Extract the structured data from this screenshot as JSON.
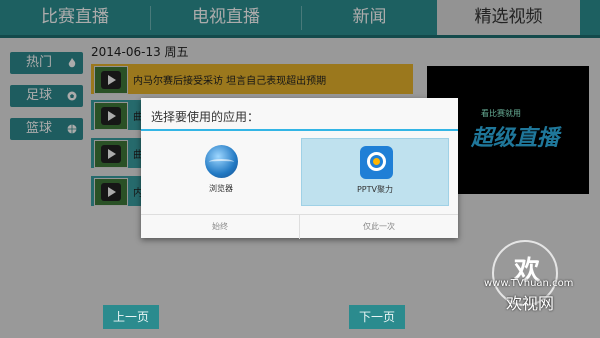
{
  "tabs": [
    {
      "label": "比赛直播"
    },
    {
      "label": "电视直播"
    },
    {
      "label": "新闻"
    },
    {
      "label": "精选视频"
    }
  ],
  "sidebar": [
    {
      "label": "热门",
      "icon": "flame-icon"
    },
    {
      "label": "足球",
      "icon": "soccer-ball-icon"
    },
    {
      "label": "篮球",
      "icon": "basketball-icon"
    }
  ],
  "content": {
    "date": "2014-06-13 周五",
    "rows": [
      {
        "text": "内马尔赛后接受采访 坦言自己表现超出预期"
      },
      {
        "text": "曲"
      },
      {
        "text": "曲"
      },
      {
        "text": "内"
      }
    ]
  },
  "player": {
    "brand_small": "看比赛就用",
    "brand_big": "超级直播"
  },
  "pager": {
    "prev": "上一页",
    "next": "下一页"
  },
  "dialog": {
    "title": "选择要使用的应用：",
    "options": [
      {
        "label": "浏览器",
        "icon": "globe-icon"
      },
      {
        "label": "PPTV聚力",
        "icon": "pptv-icon"
      }
    ],
    "always": "始终",
    "just_once": "仅此一次"
  },
  "watermark": {
    "mark": "欢",
    "url": "www.TVhuan.com",
    "name": "欢视网"
  },
  "colors": {
    "header": "#2c8f91",
    "accent": "#33b5e5",
    "highlight": "#e7b42c"
  }
}
